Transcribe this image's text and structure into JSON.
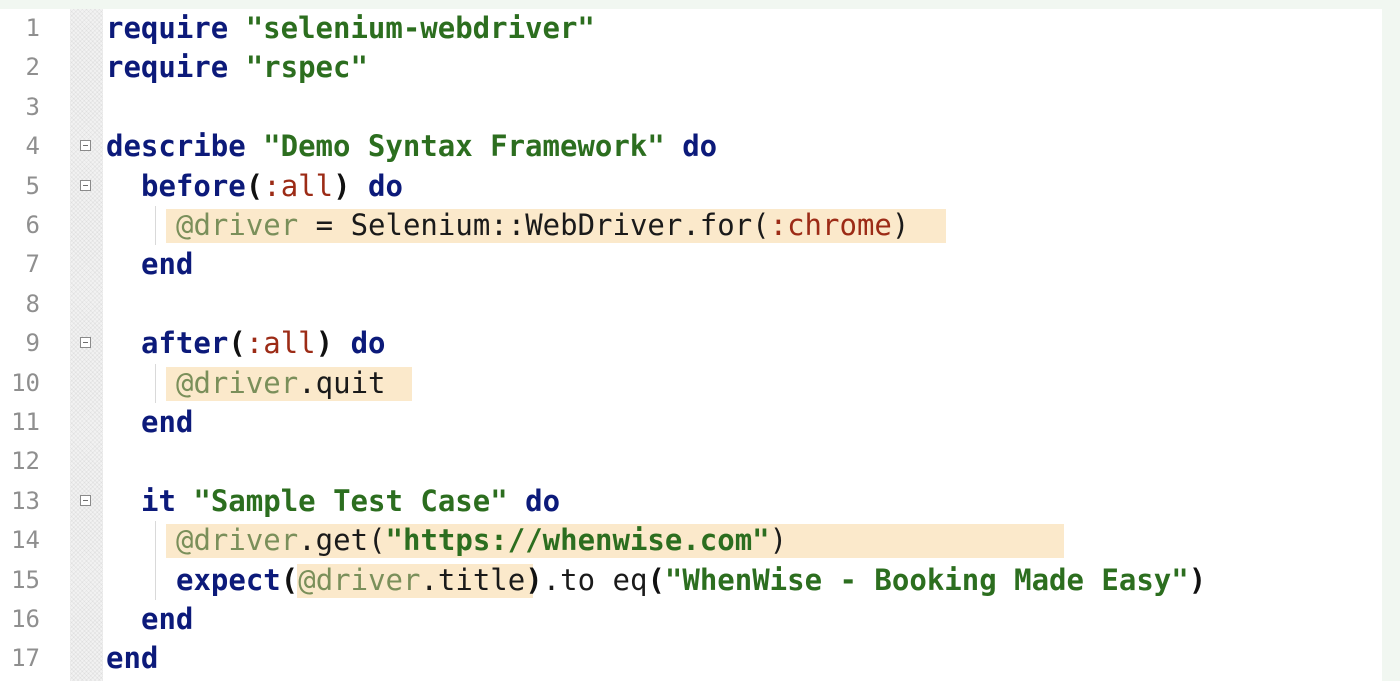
{
  "editor": {
    "lines": [
      {
        "num": "1",
        "tokens": [
          "require",
          " ",
          "\"selenium-webdriver\""
        ]
      },
      {
        "num": "2",
        "tokens": [
          "require",
          " ",
          "\"rspec\""
        ]
      },
      {
        "num": "3",
        "tokens": []
      },
      {
        "num": "4",
        "tokens": [
          "describe",
          " ",
          "\"Demo Syntax Framework\"",
          " ",
          "do"
        ]
      },
      {
        "num": "5",
        "tokens": [
          "before",
          "(",
          ":all",
          ")",
          " ",
          "do"
        ]
      },
      {
        "num": "6",
        "tokens": [
          "@driver",
          " = Selenium::WebDriver.for",
          "(",
          ":chrome",
          ")"
        ]
      },
      {
        "num": "7",
        "tokens": [
          "end"
        ]
      },
      {
        "num": "8",
        "tokens": []
      },
      {
        "num": "9",
        "tokens": [
          "after",
          "(",
          ":all",
          ")",
          " ",
          "do"
        ]
      },
      {
        "num": "10",
        "tokens": [
          "@driver",
          ".quit"
        ]
      },
      {
        "num": "11",
        "tokens": [
          "end"
        ]
      },
      {
        "num": "12",
        "tokens": []
      },
      {
        "num": "13",
        "tokens": [
          "it",
          " ",
          "\"Sample Test Case\"",
          " ",
          "do"
        ]
      },
      {
        "num": "14",
        "tokens": [
          "@driver",
          ".get",
          "(",
          "\"https://whenwise.com\"",
          ")"
        ]
      },
      {
        "num": "15",
        "tokens": [
          "expect",
          "(",
          "@driver",
          ".title",
          ")",
          ".to eq",
          "(",
          "\"WhenWise - Booking Made Easy\"",
          ")"
        ]
      },
      {
        "num": "16",
        "tokens": [
          "end"
        ]
      },
      {
        "num": "17",
        "tokens": [
          "end"
        ]
      }
    ]
  }
}
